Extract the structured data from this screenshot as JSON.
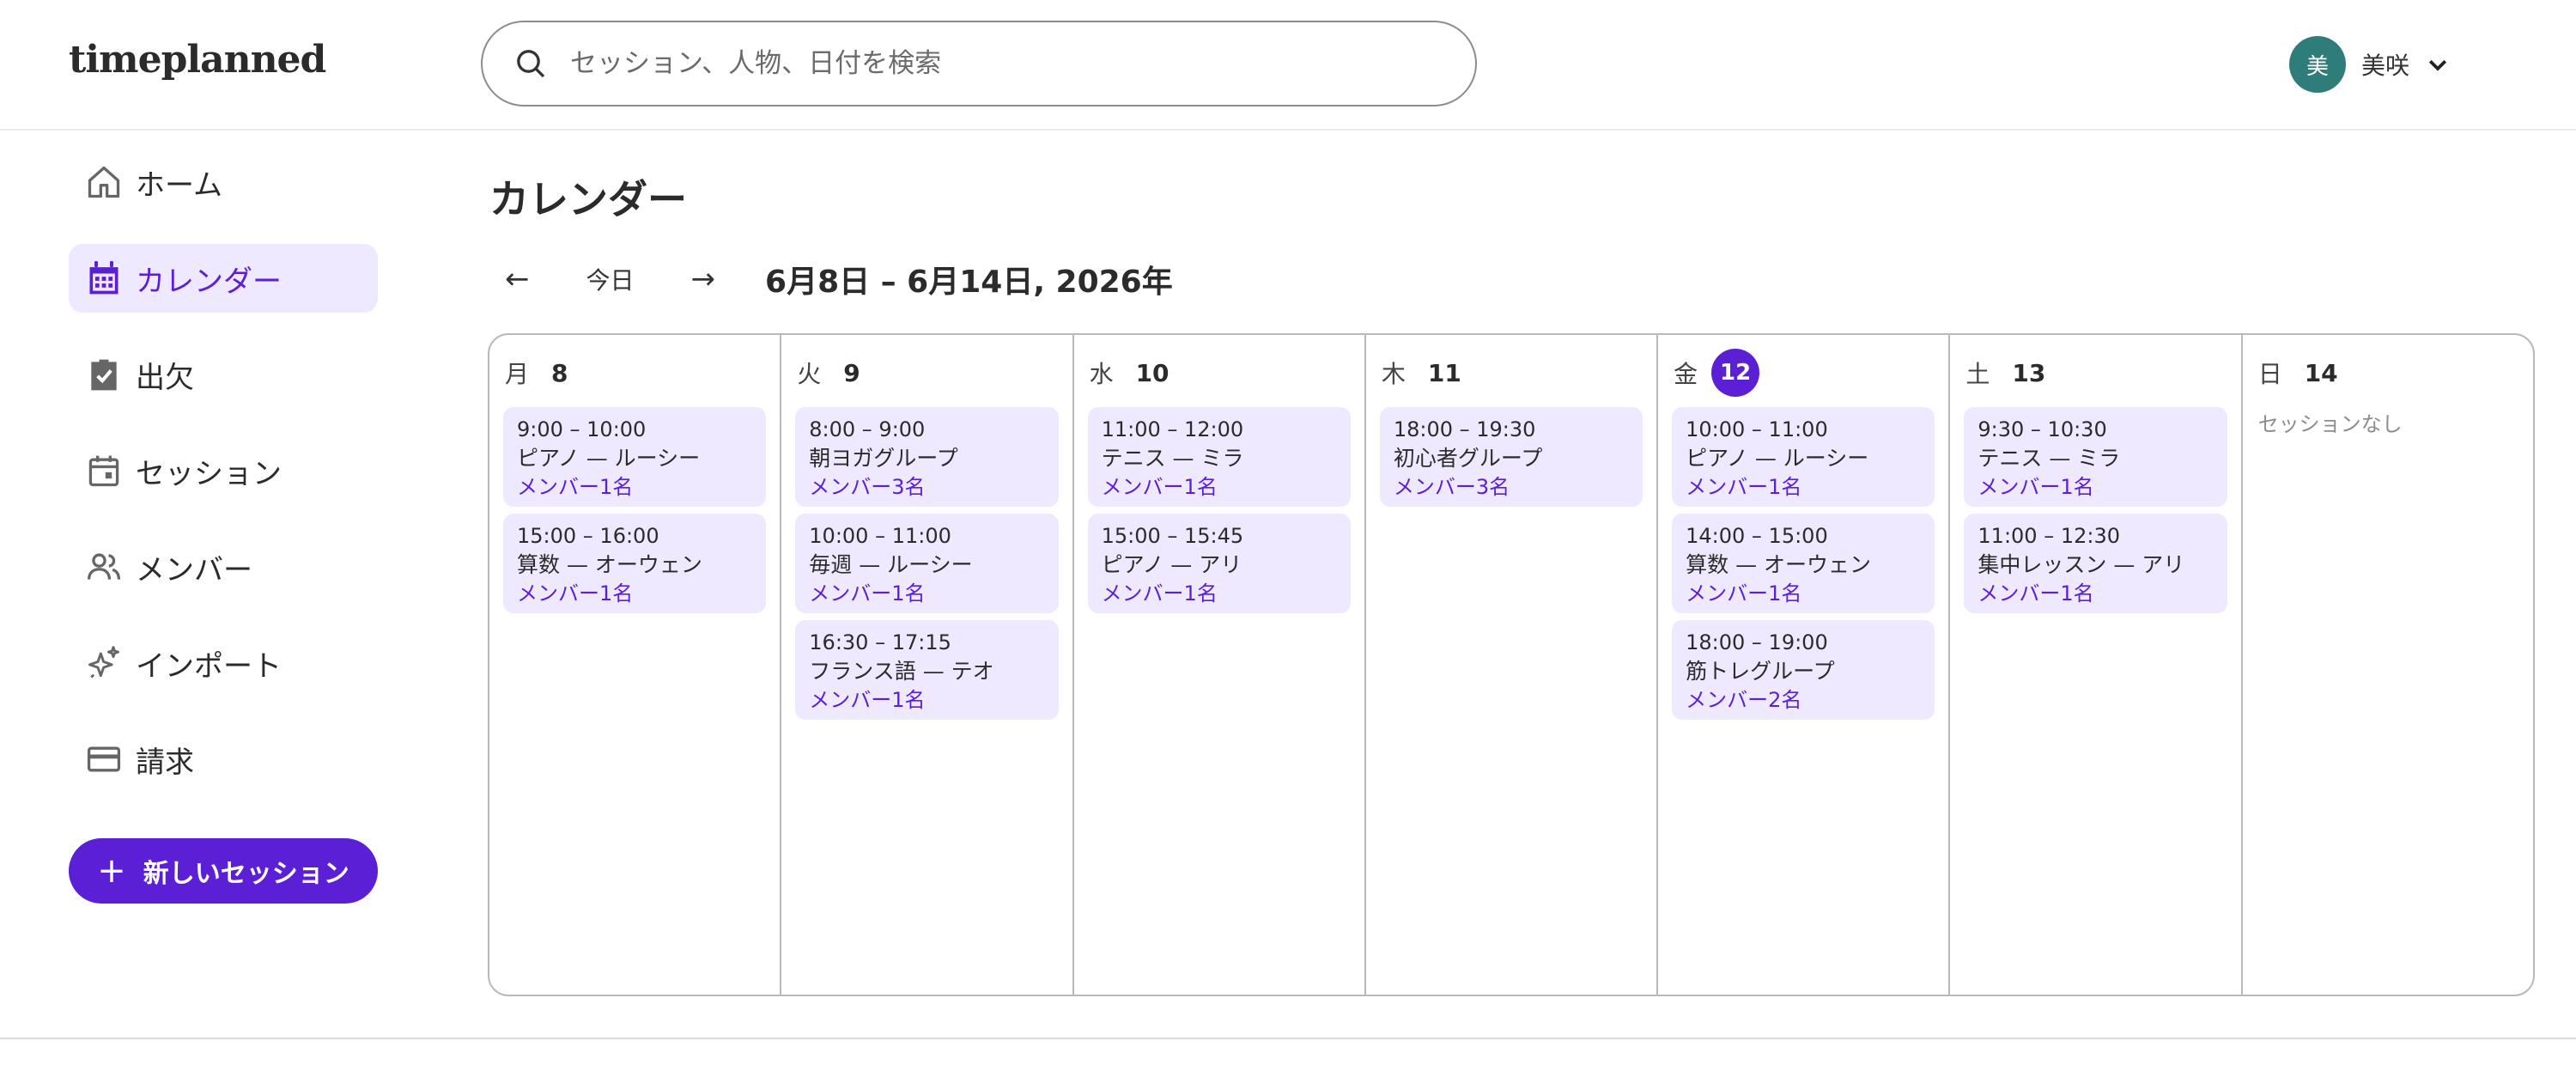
{
  "app": {
    "name": "timeplanned"
  },
  "search": {
    "placeholder": "セッション、人物、日付を検索"
  },
  "user": {
    "initial": "美",
    "name": "美咲",
    "avatar_color": "#2f7d7a"
  },
  "colors": {
    "accent": "#5b1fd6",
    "event_bg": "#efe9ff",
    "active_nav_bg": "#efe9ff"
  },
  "sidebar": {
    "items": [
      {
        "label": "ホーム",
        "icon": "home-icon",
        "active": false
      },
      {
        "label": "カレンダー",
        "icon": "calendar-grid-icon",
        "active": true
      },
      {
        "label": "出欠",
        "icon": "clipboard-check-icon",
        "active": false
      },
      {
        "label": "セッション",
        "icon": "calendar-icon",
        "active": false
      },
      {
        "label": "メンバー",
        "icon": "people-icon",
        "active": false
      },
      {
        "label": "インポート",
        "icon": "sparkle-icon",
        "active": false
      },
      {
        "label": "請求",
        "icon": "credit-card-icon",
        "active": false
      }
    ],
    "new_session_label": "新しいセッション"
  },
  "main": {
    "title": "カレンダー",
    "toolbar": {
      "prev": "←",
      "today": "今日",
      "next": "→",
      "range": "6月8日 – 6月14日, 2026年"
    }
  },
  "calendar": {
    "days": [
      {
        "dow": "月",
        "date": "8",
        "today": false,
        "events": [
          {
            "time": "9:00 – 10:00",
            "title": "ピアノ — ルーシー",
            "members": "メンバー1名"
          },
          {
            "time": "15:00 – 16:00",
            "title": "算数 — オーウェン",
            "members": "メンバー1名"
          }
        ]
      },
      {
        "dow": "火",
        "date": "9",
        "today": false,
        "events": [
          {
            "time": "8:00 – 9:00",
            "title": "朝ヨガグループ",
            "members": "メンバー3名"
          },
          {
            "time": "10:00 – 11:00",
            "title": "毎週 — ルーシー",
            "members": "メンバー1名"
          },
          {
            "time": "16:30 – 17:15",
            "title": "フランス語 — テオ",
            "members": "メンバー1名"
          }
        ]
      },
      {
        "dow": "水",
        "date": "10",
        "today": false,
        "events": [
          {
            "time": "11:00 – 12:00",
            "title": "テニス — ミラ",
            "members": "メンバー1名"
          },
          {
            "time": "15:00 – 15:45",
            "title": "ピアノ — アリ",
            "members": "メンバー1名"
          }
        ]
      },
      {
        "dow": "木",
        "date": "11",
        "today": false,
        "events": [
          {
            "time": "18:00 – 19:30",
            "title": "初心者グループ",
            "members": "メンバー3名"
          }
        ]
      },
      {
        "dow": "金",
        "date": "12",
        "today": true,
        "events": [
          {
            "time": "10:00 – 11:00",
            "title": "ピアノ — ルーシー",
            "members": "メンバー1名"
          },
          {
            "time": "14:00 – 15:00",
            "title": "算数 — オーウェン",
            "members": "メンバー1名"
          },
          {
            "time": "18:00 – 19:00",
            "title": "筋トレグループ",
            "members": "メンバー2名"
          }
        ]
      },
      {
        "dow": "土",
        "date": "13",
        "today": false,
        "events": [
          {
            "time": "9:30 – 10:30",
            "title": "テニス — ミラ",
            "members": "メンバー1名"
          },
          {
            "time": "11:00 – 12:30",
            "title": "集中レッスン — アリ",
            "members": "メンバー1名"
          }
        ]
      },
      {
        "dow": "日",
        "date": "14",
        "today": false,
        "events": [],
        "empty_label": "セッションなし"
      }
    ]
  }
}
